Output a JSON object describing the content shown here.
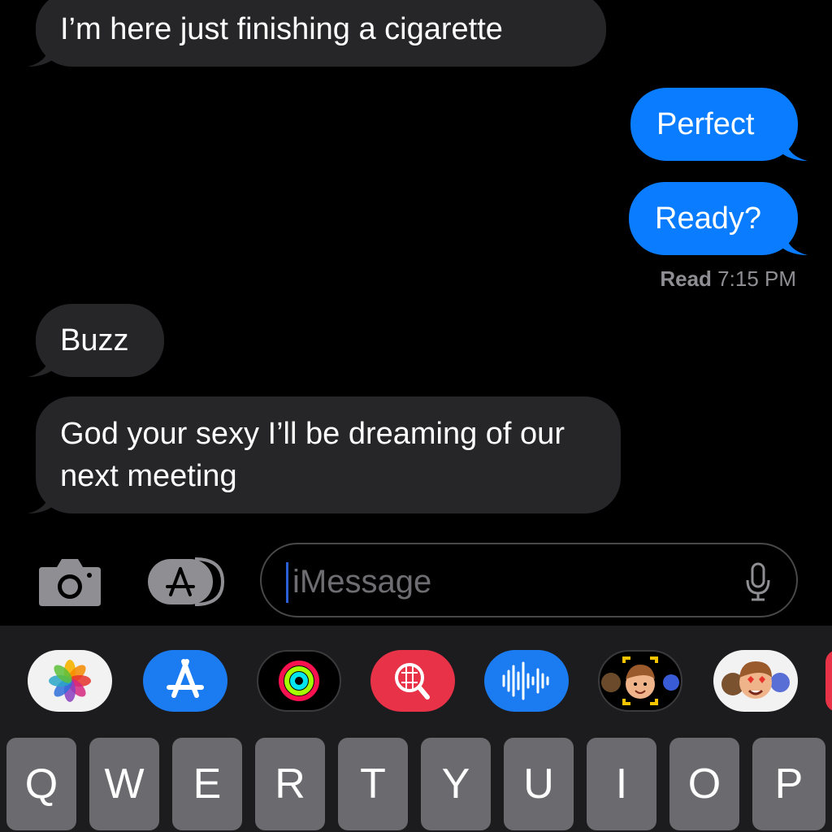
{
  "messages": [
    {
      "side": "received",
      "text": "I’m here just finishing a cigarette"
    },
    {
      "side": "sent",
      "text": "Perfect"
    },
    {
      "side": "sent",
      "text": "Ready?"
    },
    {
      "side": "received",
      "text": "Buzz"
    },
    {
      "side": "received",
      "text": "God your sexy I’ll be dreaming of our next meeting"
    }
  ],
  "read_receipt": {
    "label": "Read",
    "time": "7:15 PM"
  },
  "input": {
    "placeholder": "iMessage"
  },
  "app_drawer": [
    "photos-icon",
    "app-store-icon",
    "fitness-rings-icon",
    "image-search-icon",
    "audio-message-icon",
    "memoji-icon",
    "memoji-stickers-icon"
  ],
  "keyboard": {
    "row1": [
      "Q",
      "W",
      "E",
      "R",
      "T",
      "Y",
      "U",
      "I",
      "O",
      "P"
    ]
  },
  "colors": {
    "background": "#000000",
    "received_bubble": "#262628",
    "sent_bubble": "#0a7cff",
    "keyboard_key": "#6b6b6f"
  }
}
